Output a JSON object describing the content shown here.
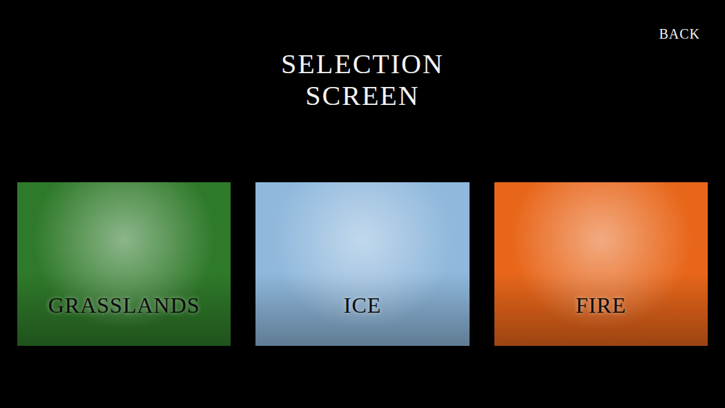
{
  "screen": {
    "title": "SELECTION SCREEN",
    "back_button": "BACK"
  },
  "levels": [
    {
      "label": "GRASSLANDS",
      "color": "#2f7a2a"
    },
    {
      "label": "ICE",
      "color": "#8fb8dc"
    },
    {
      "label": "FIRE",
      "color": "#e8661a"
    }
  ]
}
